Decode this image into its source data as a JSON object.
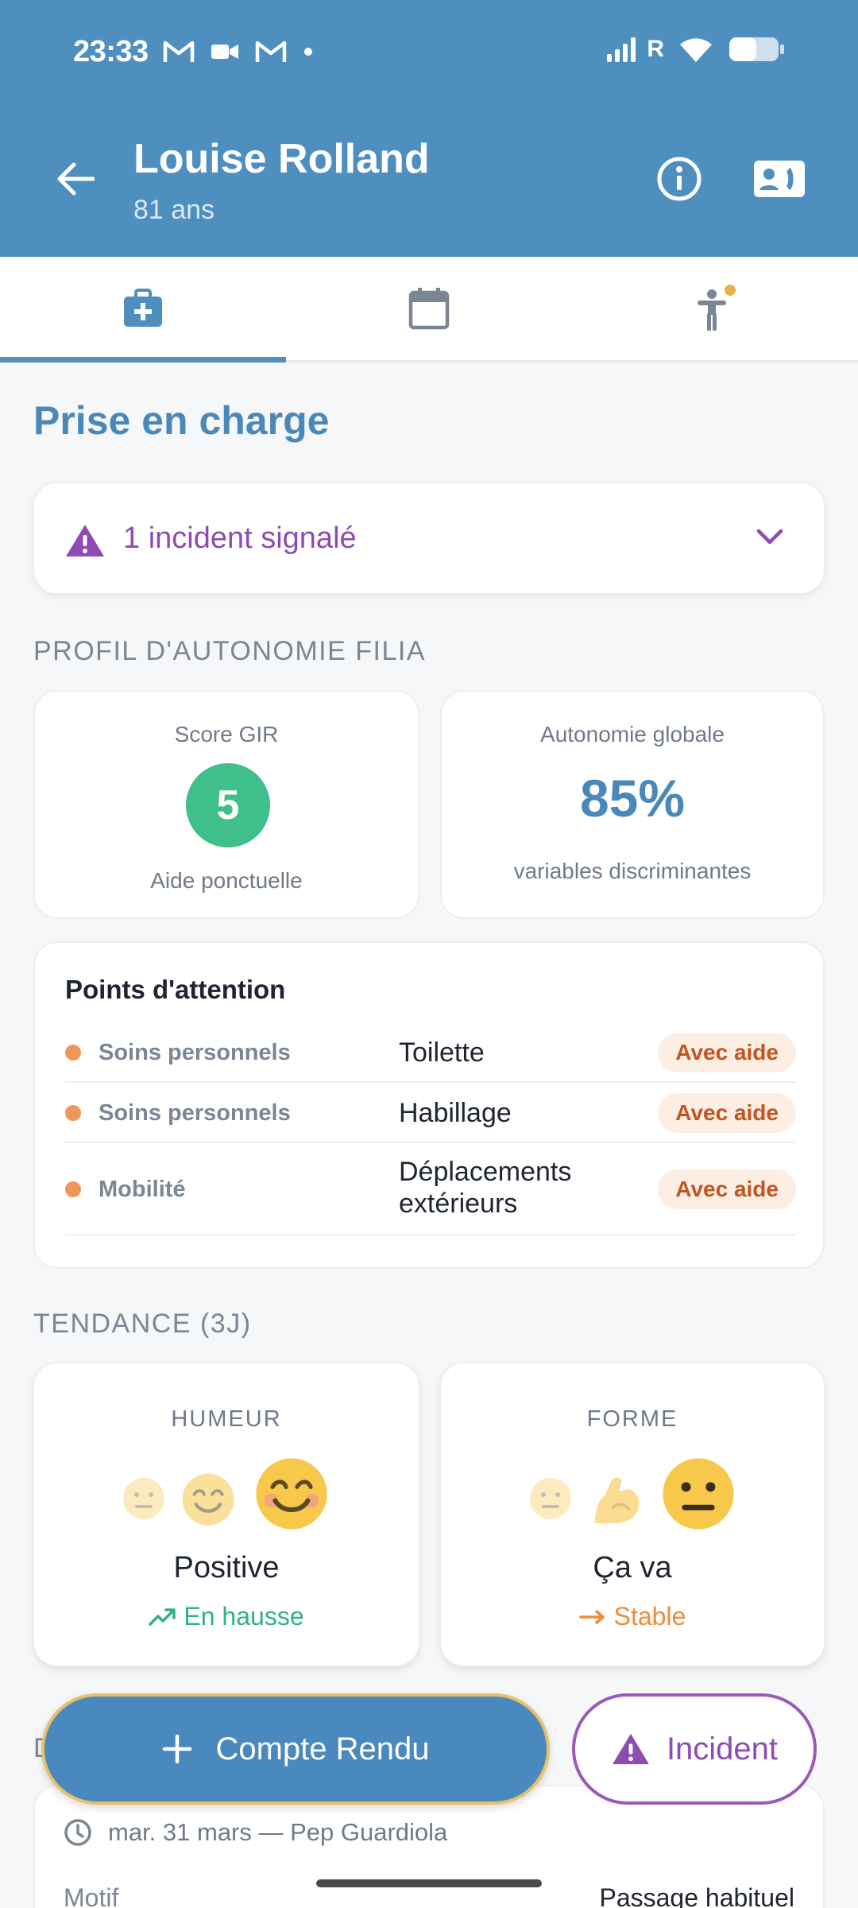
{
  "status_bar": {
    "time": "23:33",
    "network": "R"
  },
  "header": {
    "name": "Louise Rolland",
    "age": "81 ans"
  },
  "tabs": [
    {
      "icon": "medical-bag-icon",
      "active": true
    },
    {
      "icon": "calendar-icon",
      "active": false
    },
    {
      "icon": "accessibility-icon",
      "active": false,
      "has_dot": true
    }
  ],
  "page": {
    "title": "Prise en charge"
  },
  "incident_banner": {
    "label": "1 incident signalé"
  },
  "autonomy": {
    "caption": "PROFIL D'AUTONOMIE FILIA",
    "gir": {
      "label": "Score GIR",
      "score": "5",
      "description": "Aide ponctuelle"
    },
    "global": {
      "label": "Autonomie globale",
      "value": "85%",
      "description": "variables discriminantes"
    }
  },
  "attention": {
    "title": "Points d'attention",
    "rows": [
      {
        "category": "Soins personnels",
        "item": "Toilette",
        "badge": "Avec aide"
      },
      {
        "category": "Soins personnels",
        "item": "Habillage",
        "badge": "Avec aide"
      },
      {
        "category": "Mobilité",
        "item": "Déplacements extérieurs",
        "badge": "Avec aide"
      }
    ]
  },
  "trend": {
    "caption": "TENDANCE (3J)",
    "mood": {
      "label": "HUMEUR",
      "value": "Positive",
      "trend": "En hausse",
      "trend_color": "#2fb37e"
    },
    "form": {
      "label": "FORME",
      "value": "Ça va",
      "trend": "Stable",
      "trend_color": "#ef8b3b"
    }
  },
  "last_report": {
    "letter": "D",
    "date": "mar. 31 mars — Pep Guardiola",
    "motif_label": "Motif",
    "motif_value": "Passage habituel"
  },
  "actions": {
    "report_label": "Compte Rendu",
    "incident_label": "Incident"
  },
  "colors": {
    "primary": "#4f8fc0",
    "incident": "#8e4bb3",
    "gir": "#3fbf8a",
    "badge": "#c2541f"
  }
}
